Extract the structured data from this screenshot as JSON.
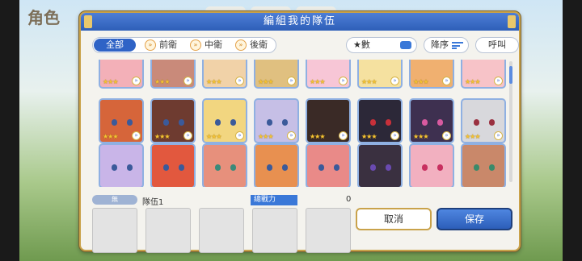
{
  "background": {
    "title": "角色"
  },
  "dialog": {
    "title": "編組我的隊伍"
  },
  "filter_tabs": [
    {
      "label": "全部",
      "active": true
    },
    {
      "label": "前衛",
      "active": false
    },
    {
      "label": "中衛",
      "active": false
    },
    {
      "label": "後衛",
      "active": false
    }
  ],
  "sort_field": {
    "label": "★數"
  },
  "sort_order": {
    "label": "降序"
  },
  "call_button": {
    "label": "呼叫"
  },
  "party": {
    "badge": "無",
    "name": "隊伍1",
    "power_label": "總戰力",
    "power_value": "0"
  },
  "buttons": {
    "cancel": "取消",
    "save": "保存"
  },
  "roster_rows": [
    {
      "stars": [
        "★★★",
        "★★★",
        "★★★",
        "★★★",
        "★★★",
        "★★★",
        "★★★",
        "★★★"
      ]
    },
    {
      "stars": [
        "★★★",
        "★★★",
        "★★★",
        "★★★",
        "★★★",
        "★★★",
        "★★★",
        "★★★"
      ]
    },
    {
      "stars": [
        "",
        "",
        "",
        "",
        "",
        "",
        "",
        ""
      ]
    }
  ],
  "colors": {
    "accent": "#2f63c6",
    "frame_gold": "#c9a24a"
  }
}
